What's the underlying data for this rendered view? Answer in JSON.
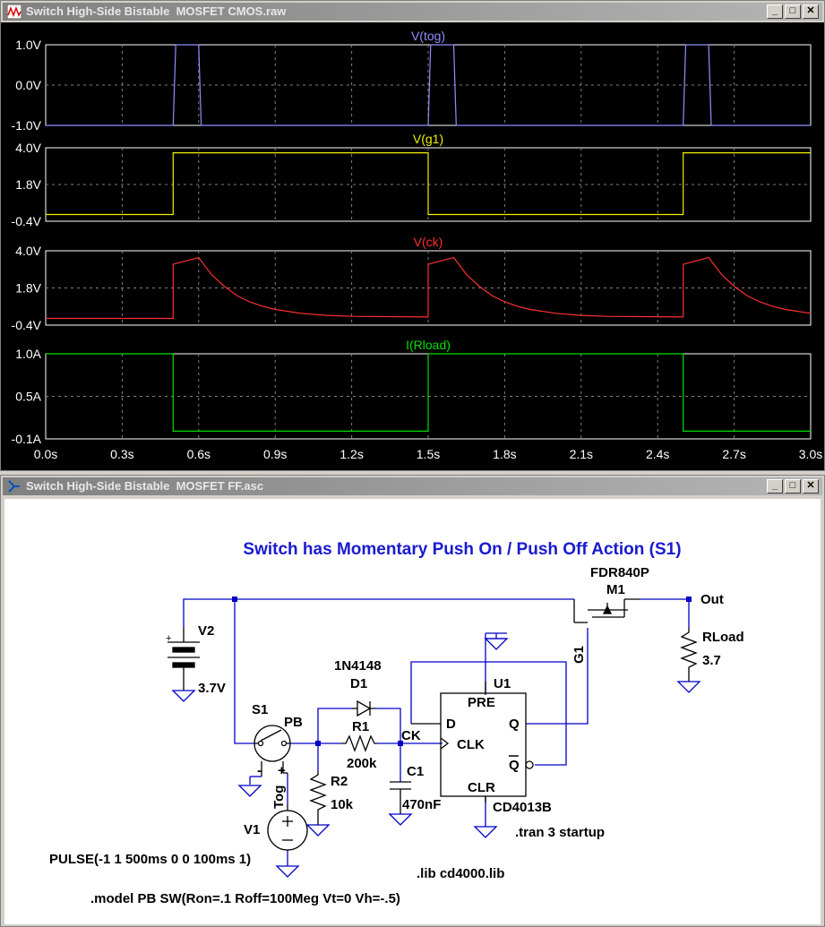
{
  "waveform_window": {
    "title": "Switch High-Side Bistable  MOSFET CMOS.raw",
    "buttons": {
      "minimize": "_",
      "maximize": "□",
      "close": "✕"
    }
  },
  "schematic_window": {
    "title": "Switch High-Side Bistable  MOSFET FF.asc",
    "buttons": {
      "minimize": "_",
      "maximize": "□",
      "close": "✕"
    }
  },
  "chart_data": [
    {
      "type": "line",
      "title": "V(tog)",
      "color": "#8f8fff",
      "y_tick_labels": [
        "1.0V",
        "0.0V",
        "-1.0V"
      ],
      "ylim": [
        -1.0,
        1.0
      ],
      "x": [
        0.0,
        0.5,
        0.51,
        0.6,
        0.61,
        1.5,
        1.51,
        1.6,
        1.61,
        2.5,
        2.51,
        2.6,
        2.61,
        3.0
      ],
      "y": [
        -1,
        -1,
        1,
        1,
        -1,
        -1,
        1,
        1,
        -1,
        -1,
        1,
        1,
        -1,
        -1
      ]
    },
    {
      "type": "line",
      "title": "V(g1)",
      "color": "#f0f000",
      "y_tick_labels": [
        "4.0V",
        "1.8V",
        "-0.4V"
      ],
      "ylim": [
        -0.4,
        4.0
      ],
      "x": [
        0.0,
        0.5,
        0.5,
        1.5,
        1.5,
        2.5,
        2.5,
        3.0
      ],
      "y": [
        0.0,
        0.0,
        3.7,
        3.7,
        0.0,
        0.0,
        3.7,
        3.7
      ]
    },
    {
      "type": "line",
      "title": "V(ck)",
      "color": "#ff3030",
      "y_tick_labels": [
        "4.0V",
        "1.8V",
        "-0.4V"
      ],
      "ylim": [
        -0.4,
        4.0
      ],
      "x": [
        0.0,
        0.5,
        0.5,
        0.6,
        0.65,
        0.7,
        0.75,
        0.8,
        0.85,
        0.9,
        1.0,
        1.1,
        1.2,
        1.5,
        1.5,
        1.6,
        1.65,
        1.7,
        1.75,
        1.8,
        1.85,
        1.9,
        2.0,
        2.1,
        2.2,
        2.5,
        2.5,
        2.6,
        2.65,
        2.7,
        2.75,
        2.8,
        2.85,
        2.9,
        3.0
      ],
      "y": [
        0.0,
        0.0,
        3.2,
        3.6,
        2.6,
        1.9,
        1.35,
        0.98,
        0.72,
        0.53,
        0.3,
        0.18,
        0.12,
        0.08,
        3.2,
        3.6,
        2.6,
        1.9,
        1.35,
        0.98,
        0.72,
        0.53,
        0.3,
        0.18,
        0.12,
        0.08,
        3.2,
        3.6,
        2.6,
        1.9,
        1.35,
        0.98,
        0.72,
        0.53,
        0.3
      ]
    },
    {
      "type": "line",
      "title": "I(Rload)",
      "color": "#00e000",
      "y_tick_labels": [
        "1.0A",
        "0.5A",
        "-0.1A"
      ],
      "ylim": [
        -0.1,
        1.0
      ],
      "x": [
        0.0,
        0.5,
        0.5,
        1.5,
        1.5,
        2.5,
        2.5,
        3.0
      ],
      "y": [
        1.0,
        1.0,
        0.0,
        0.0,
        1.0,
        1.0,
        0.0,
        0.0
      ]
    }
  ],
  "x_axis": {
    "xlim": [
      0.0,
      3.0
    ],
    "tick_labels": [
      "0.0s",
      "0.3s",
      "0.6s",
      "0.9s",
      "1.2s",
      "1.5s",
      "1.8s",
      "2.1s",
      "2.4s",
      "2.7s",
      "3.0s"
    ],
    "grid": true
  },
  "schematic": {
    "heading": "Switch has Momentary Push On / Push Off Action (S1)",
    "labels": {
      "mosfet_part": "FDR840P",
      "mosfet_ref": "M1",
      "out_net": "Out",
      "v2_ref": "V2",
      "v2_value": "3.7V",
      "rload_ref": "RLoad",
      "rload_value": "3.7",
      "g1_net": "G1",
      "diode_part": "1N4148",
      "diode_ref": "D1",
      "u1_ref": "U1",
      "pre_pin": "PRE",
      "d_pin": "D",
      "q_pin": "Q",
      "clk_pin": "CLK",
      "qbar_pin": "Q",
      "clr_pin": "CLR",
      "ic_part": "CD4013B",
      "s1_ref": "S1",
      "pb_model": "PB",
      "r1_ref": "R1",
      "r1_value": "200k",
      "ck_net": "CK",
      "c1_ref": "C1",
      "c1_value": "470nF",
      "r2_ref": "R2",
      "r2_value": "10k",
      "tog_net": "Tog",
      "v1_ref": "V1",
      "switch_minus": "-",
      "switch_plus": "+",
      "v1_value": "PULSE(-1 1 500ms 0 0 100ms 1)",
      "tran_directive": ".tran 3 startup",
      "lib_directive": ".lib cd4000.lib",
      "model_directive": ".model PB SW(Ron=.1 Roff=100Meg Vt=0 Vh=-.5)"
    }
  }
}
